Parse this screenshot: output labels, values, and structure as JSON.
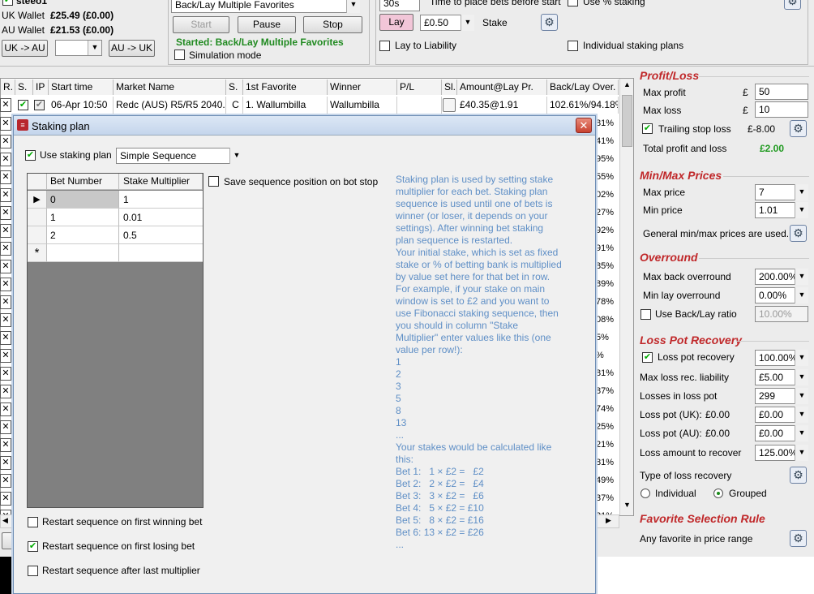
{
  "top": {
    "account": "steeo1",
    "uk_wallet_label": "UK Wallet",
    "uk_wallet_value": "£25.49 (£0.00)",
    "au_wallet_label": "AU Wallet",
    "au_wallet_value": "£21.53 (£0.00)",
    "uk_to_au": "UK -> AU",
    "au_to_uk": "AU -> UK",
    "strategy": "Back/Lay Multiple Favorites",
    "start": "Start",
    "pause": "Pause",
    "stop": "Stop",
    "status": "Started: Back/Lay Multiple Favorites",
    "simulation": "Simulation mode",
    "time_value": "30s",
    "time_label": "Time to place bets before start",
    "lay": "Lay",
    "stake_value": "£0.50",
    "stake_label": "Stake",
    "use_pct_staking": "Use % staking",
    "lay_to_liability": "Lay to Liability",
    "individual_plans": "Individual staking plans"
  },
  "grid": {
    "headers": [
      "R.",
      "S.",
      "IP",
      "Start time",
      "Market Name",
      "S.",
      "1st Favorite",
      "Winner",
      "P/L",
      "Sl.",
      "Amount@Lay Pr.",
      "Back/Lay Over."
    ],
    "row": {
      "start_time": "06-Apr 10:50",
      "market": "Redc (AUS)  R5/R5 2040...",
      "s": "C",
      "favorite": "1. Wallumbilla",
      "winner": "Wallumbilla",
      "amount": "£40.35@1.91",
      "over": "102.61%/94.18%"
    },
    "side_pct": [
      "81%",
      "41%",
      "95%",
      "55%",
      "02%",
      "27%",
      "92%",
      "91%",
      "85%",
      "89%",
      "78%",
      "08%",
      "5%",
      "%",
      "81%",
      "87%",
      "74%",
      "25%",
      "21%",
      "81%",
      "49%",
      "37%",
      "21%"
    ]
  },
  "right": {
    "profit_loss_title": "Profit/Loss",
    "max_profit_label": "Max profit",
    "max_profit_value": "50",
    "max_loss_label": "Max loss",
    "max_loss_value": "10",
    "currency": "£",
    "trailing_stop_label": "Trailing stop loss",
    "trailing_stop_value": "£-8.00",
    "total_pl_label": "Total profit and loss",
    "total_pl_value": "£2.00",
    "minmax_title": "Min/Max Prices",
    "max_price_label": "Max price",
    "max_price_value": "7",
    "min_price_label": "Min price",
    "min_price_value": "1.01",
    "general_minmax": "General min/max prices are used.",
    "overround_title": "Overround",
    "max_back_label": "Max back overround",
    "max_back_value": "200.00%",
    "min_lay_label": "Min lay overround",
    "min_lay_value": "0.00%",
    "use_backlay_ratio": "Use Back/Lay ratio",
    "backlay_ratio_value": "10.00%",
    "loss_pot_title": "Loss Pot Recovery",
    "loss_pot_recovery_label": "Loss pot recovery",
    "loss_pot_recovery_value": "100.00%",
    "max_loss_rec_label": "Max loss rec. liability",
    "max_loss_rec_value": "£5.00",
    "losses_label": "Losses in loss pot",
    "losses_value": "299",
    "loss_pot_uk_label": "Loss pot (UK):",
    "loss_pot_uk_amount": "£0.00",
    "loss_pot_uk_value": "£0.00",
    "loss_pot_au_label": "Loss pot (AU):",
    "loss_pot_au_amount": "£0.00",
    "loss_pot_au_value": "£0.00",
    "loss_amount_label": "Loss amount to recover",
    "loss_amount_value": "125.00%",
    "type_label": "Type of loss recovery",
    "individual": "Individual",
    "grouped": "Grouped",
    "fav_rule_title": "Favorite Selection Rule",
    "fav_rule_text": "Any favorite in price range"
  },
  "dialog": {
    "title": "Staking plan",
    "use_staking_plan": "Use staking plan",
    "plan_type": "Simple Sequence",
    "col_bet": "Bet Number",
    "col_mult": "Stake Multiplier",
    "rows": [
      [
        "0",
        "1"
      ],
      [
        "1",
        "0.01"
      ],
      [
        "2",
        "0.5"
      ]
    ],
    "new_row_marker": "*",
    "save_position": "Save sequence position on bot stop",
    "restart_win": "Restart sequence on first winning bet",
    "restart_lose": "Restart sequence on first losing bet",
    "restart_last": "Restart sequence after last multiplier",
    "help_lines": [
      "Staking plan is used by setting stake",
      "multiplier for each bet. Staking plan",
      "sequence is used until one of bets is",
      "winner (or loser, it depends on your",
      "settings). After winning bet staking",
      "plan sequence is restarted.",
      "Your initial stake, which is set as fixed",
      "stake or % of betting bank is multiplied",
      "by value set here for that bet in row.",
      "For example, if your stake on main",
      "window is set to £2 and you want to",
      "use Fibonacci staking sequence, then",
      "you should in column \"Stake",
      "Multiplier\" enter values like this (one",
      "value per row!):",
      "1",
      "2",
      "3",
      "5",
      "8",
      "13",
      "...",
      "Your stakes would be calculated like",
      "this:",
      "Bet 1:   1 × £2 =   £2",
      "Bet 2:   2 × £2 =   £4",
      "Bet 3:   3 × £2 =   £6",
      "Bet 4:   5 × £2 = £10",
      "Bet 5:   8 × £2 = £16",
      "Bet 6: 13 × £2 = £26",
      "..."
    ]
  }
}
